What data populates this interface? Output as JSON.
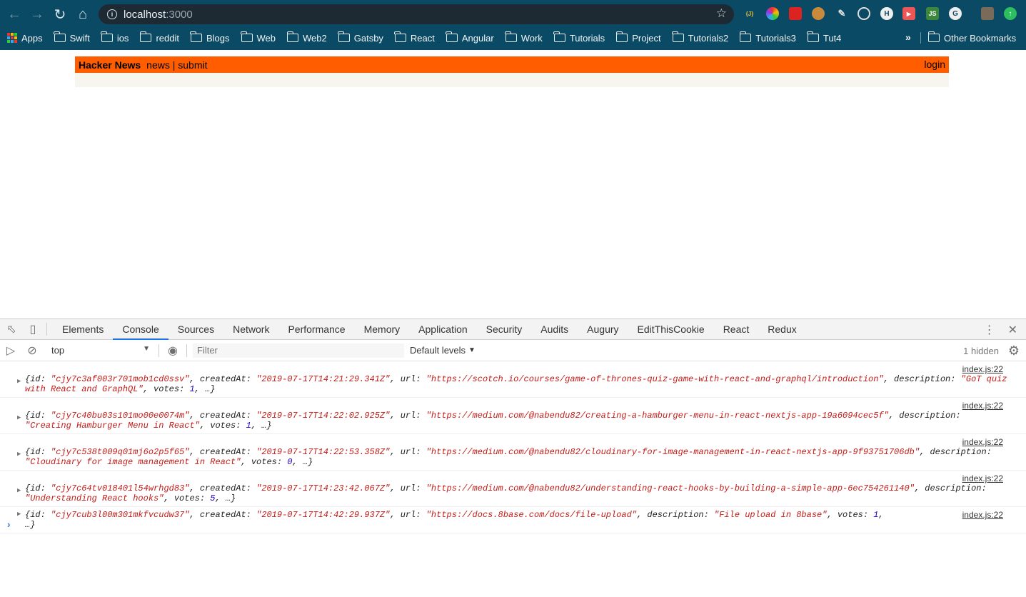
{
  "browser": {
    "url_host": "localhost",
    "url_port": ":3000",
    "bookmarks": [
      "Apps",
      "Swift",
      "ios",
      "reddit",
      "Blogs",
      "Web",
      "Web2",
      "Gatsby",
      "React",
      "Angular",
      "Work",
      "Tutorials",
      "Project",
      "Tutorials2",
      "Tutorials3",
      "Tut4"
    ],
    "overflow": "»",
    "other_bookmarks": "Other Bookmarks",
    "extension_icons": [
      "json-icon",
      "color-wheel-icon",
      "ladybug-icon",
      "cookie-icon",
      "pen-icon",
      "target-icon",
      "hash-icon",
      "record-icon",
      "nodejs-icon",
      "g-icon",
      "avatar-icon",
      "update-icon"
    ]
  },
  "page": {
    "title": "Hacker News",
    "links": "news | submit",
    "login": "login",
    "colors": {
      "header": "#ff5d00",
      "body": "#f6f6ef"
    }
  },
  "devtools": {
    "tabs": [
      "Elements",
      "Console",
      "Sources",
      "Network",
      "Performance",
      "Memory",
      "Application",
      "Security",
      "Audits",
      "Augury",
      "EditThisCookie",
      "React",
      "Redux"
    ],
    "active_tab": "Console",
    "context": "top",
    "filter_placeholder": "Filter",
    "levels": "Default levels",
    "hidden": "1 hidden",
    "logs": [
      {
        "source": "index.js:22",
        "id": "\"cjy7c3af003r701mob1cd0ssv\"",
        "createdAt": "\"2019-07-17T14:21:29.341Z\"",
        "url": "\"https://scotch.io/courses/game-of-thrones-quiz-game-with-react-and-graphql/introduction\"",
        "description": "\"GoT quiz with React and GraphQL\"",
        "votes": "1"
      },
      {
        "source": "index.js:22",
        "id": "\"cjy7c40bu03s101mo00e0074m\"",
        "createdAt": "\"2019-07-17T14:22:02.925Z\"",
        "url": "\"https://medium.com/@nabendu82/creating-a-hamburger-menu-in-react-nextjs-app-19a6094cec5f\"",
        "description": "\"Creating Hamburger Menu in React\"",
        "votes": "1"
      },
      {
        "source": "index.js:22",
        "id": "\"cjy7c538t009q01mj6o2p5f65\"",
        "createdAt": "\"2019-07-17T14:22:53.358Z\"",
        "url": "\"https://medium.com/@nabendu82/cloudinary-for-image-management-in-react-nextjs-app-9f93751706db\"",
        "description": "\"Cloudinary for image management in React\"",
        "votes": "0"
      },
      {
        "source": "index.js:22",
        "id": "\"cjy7c64tv018401l54wrhgd83\"",
        "createdAt": "\"2019-07-17T14:23:42.067Z\"",
        "url": "\"https://medium.com/@nabendu82/understanding-react-hooks-by-building-a-simple-app-6ec754261140\"",
        "description": "\"Understanding React hooks\"",
        "votes": "5"
      },
      {
        "source": "index.js:22",
        "id": "\"cjy7cub3l00m301mkfvcudw37\"",
        "createdAt": "\"2019-07-17T14:42:29.937Z\"",
        "url": "\"https://docs.8base.com/docs/file-upload\"",
        "description": "\"File upload in 8base\"",
        "votes": "1"
      }
    ]
  }
}
